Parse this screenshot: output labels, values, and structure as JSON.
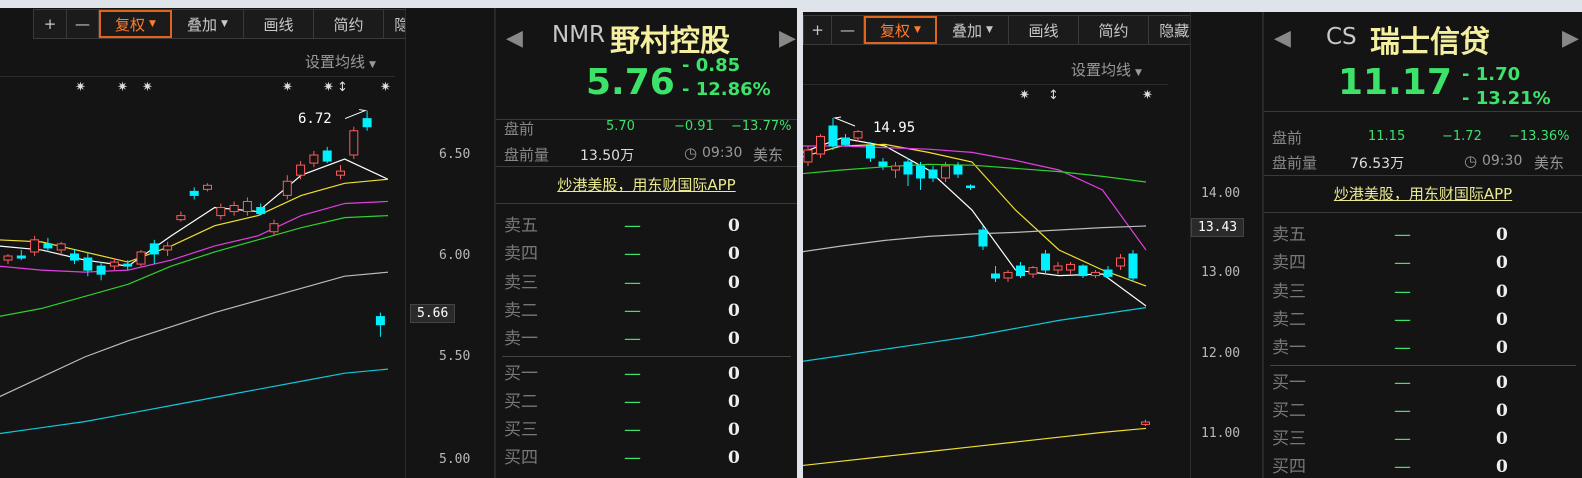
{
  "toolbar": {
    "plus": "+",
    "minus": "—",
    "fuquan": "复权",
    "diejia": "叠加",
    "huaxian": "画线",
    "jianyue": "简约",
    "yincang": "隐藏",
    "expand_icon": "expand-icon"
  },
  "ma_setting": "设置均线",
  "panels": [
    {
      "code": "NMR",
      "name": "野村控股",
      "last": "5.76",
      "change": "- 0.85",
      "change_pct": "- 12.86%",
      "pre_label": "盘前",
      "pre_price": "5.70",
      "pre_change": "−0.91",
      "pre_pct": "−13.77%",
      "pre_vol_label": "盘前量",
      "pre_vol": "13.50万",
      "time": "09:30",
      "tz": "美东",
      "promo": "炒港美股，用东财国际APP",
      "book": [
        {
          "label": "卖五",
          "dash": "—",
          "vol": "0"
        },
        {
          "label": "卖四",
          "dash": "—",
          "vol": "0"
        },
        {
          "label": "卖三",
          "dash": "—",
          "vol": "0"
        },
        {
          "label": "卖二",
          "dash": "—",
          "vol": "0"
        },
        {
          "label": "卖一",
          "dash": "—",
          "vol": "0"
        },
        {
          "label": "买一",
          "dash": "—",
          "vol": "0"
        },
        {
          "label": "买二",
          "dash": "—",
          "vol": "0"
        },
        {
          "label": "买三",
          "dash": "—",
          "vol": "0"
        },
        {
          "label": "买四",
          "dash": "—",
          "vol": "0"
        },
        {
          "label": "买五",
          "dash": "—",
          "vol": "0"
        }
      ]
    },
    {
      "code": "CS",
      "name": "瑞士信贷",
      "last": "11.17",
      "change": "- 1.70",
      "change_pct": "- 13.21%",
      "pre_label": "盘前",
      "pre_price": "11.15",
      "pre_change": "−1.72",
      "pre_pct": "−13.36%",
      "pre_vol_label": "盘前量",
      "pre_vol": "76.53万",
      "time": "09:30",
      "tz": "美东",
      "promo": "炒港美股，用东财国际APP",
      "book": [
        {
          "label": "卖五",
          "dash": "—",
          "vol": "0"
        },
        {
          "label": "卖四",
          "dash": "—",
          "vol": "0"
        },
        {
          "label": "卖三",
          "dash": "—",
          "vol": "0"
        },
        {
          "label": "卖二",
          "dash": "—",
          "vol": "0"
        },
        {
          "label": "卖一",
          "dash": "—",
          "vol": "0"
        },
        {
          "label": "买一",
          "dash": "—",
          "vol": "0"
        },
        {
          "label": "买二",
          "dash": "—",
          "vol": "0"
        },
        {
          "label": "买三",
          "dash": "—",
          "vol": "0"
        },
        {
          "label": "买四",
          "dash": "—",
          "vol": "0"
        }
      ]
    }
  ],
  "chart_data": [
    {
      "type": "candlestick",
      "yticks": [
        "6.50",
        "6.00",
        "5.50",
        "5.00"
      ],
      "current_price": "5.66",
      "high_label": "6.72",
      "colors": {
        "up": "#ff5a5a",
        "down": "#00f0ff"
      },
      "candles": [
        [
          5.98,
          6.01,
          5.96,
          6.0
        ],
        [
          6.0,
          6.03,
          5.98,
          5.99
        ],
        [
          6.02,
          6.1,
          6.0,
          6.08
        ],
        [
          6.06,
          6.09,
          6.02,
          6.04
        ],
        [
          6.03,
          6.07,
          6.0,
          6.06
        ],
        [
          6.01,
          6.03,
          5.96,
          5.98
        ],
        [
          5.99,
          6.02,
          5.9,
          5.93
        ],
        [
          5.95,
          5.97,
          5.88,
          5.91
        ],
        [
          5.95,
          5.99,
          5.93,
          5.97
        ],
        [
          5.96,
          5.98,
          5.93,
          5.95
        ],
        [
          5.96,
          6.03,
          5.95,
          6.02
        ],
        [
          6.06,
          6.08,
          5.96,
          6.01
        ],
        [
          6.03,
          6.07,
          6.0,
          6.05
        ],
        [
          6.18,
          6.22,
          6.17,
          6.2
        ],
        [
          6.32,
          6.34,
          6.28,
          6.3
        ],
        [
          6.33,
          6.36,
          6.32,
          6.35
        ],
        [
          6.2,
          6.26,
          6.18,
          6.24
        ],
        [
          6.22,
          6.27,
          6.2,
          6.25
        ],
        [
          6.22,
          6.29,
          6.2,
          6.27
        ],
        [
          6.24,
          6.26,
          6.2,
          6.21
        ],
        [
          6.12,
          6.18,
          6.1,
          6.16
        ],
        [
          6.3,
          6.4,
          6.28,
          6.37
        ],
        [
          6.4,
          6.47,
          6.38,
          6.45
        ],
        [
          6.46,
          6.52,
          6.44,
          6.5
        ],
        [
          6.52,
          6.54,
          6.46,
          6.47
        ],
        [
          6.4,
          6.45,
          6.38,
          6.42
        ],
        [
          6.5,
          6.64,
          6.48,
          6.62
        ],
        [
          6.68,
          6.72,
          6.62,
          6.64
        ],
        [
          5.7,
          5.72,
          5.6,
          5.66
        ]
      ],
      "ma": [
        {
          "color": "#ffffff",
          "values": [
            6.05,
            6.03,
            5.98,
            5.95,
            6.1,
            6.24,
            6.22,
            6.4,
            6.48,
            6.38
          ]
        },
        {
          "color": "#f0e030",
          "values": [
            6.08,
            6.07,
            6.02,
            5.97,
            6.05,
            6.15,
            6.2,
            6.3,
            6.36,
            6.38
          ]
        },
        {
          "color": "#e040e0",
          "values": [
            5.95,
            5.93,
            5.92,
            5.93,
            5.98,
            6.05,
            6.1,
            6.2,
            6.26,
            6.27
          ]
        },
        {
          "color": "#30d030",
          "values": [
            5.7,
            5.74,
            5.8,
            5.86,
            5.95,
            6.02,
            6.08,
            6.14,
            6.19,
            6.2
          ]
        },
        {
          "color": "#bbbbbb",
          "values": [
            5.3,
            5.4,
            5.5,
            5.58,
            5.65,
            5.72,
            5.78,
            5.84,
            5.9,
            5.92
          ]
        },
        {
          "color": "#10c8d8",
          "values": [
            5.12,
            5.15,
            5.18,
            5.22,
            5.26,
            5.3,
            5.34,
            5.38,
            5.42,
            5.44
          ]
        }
      ]
    },
    {
      "type": "candlestick",
      "yticks": [
        "14.00",
        "13.00",
        "12.00",
        "11.00"
      ],
      "current_price": "13.43",
      "high_label": "14.95",
      "colors": {
        "up": "#ff5a5a",
        "down": "#00f0ff"
      },
      "candles": [
        [
          14.4,
          14.6,
          14.35,
          14.55
        ],
        [
          14.5,
          14.75,
          14.45,
          14.72
        ],
        [
          14.85,
          14.95,
          14.55,
          14.6
        ],
        [
          14.7,
          14.75,
          14.6,
          14.62
        ],
        [
          14.7,
          14.8,
          14.65,
          14.78
        ],
        [
          14.6,
          14.65,
          14.4,
          14.45
        ],
        [
          14.4,
          14.45,
          14.3,
          14.35
        ],
        [
          14.3,
          14.4,
          14.2,
          14.35
        ],
        [
          14.4,
          14.45,
          14.1,
          14.25
        ],
        [
          14.35,
          14.4,
          14.05,
          14.2
        ],
        [
          14.3,
          14.35,
          14.15,
          14.2
        ],
        [
          14.2,
          14.4,
          14.15,
          14.35
        ],
        [
          14.35,
          14.4,
          14.2,
          14.25
        ],
        [
          14.1,
          14.12,
          14.05,
          14.08
        ],
        [
          13.55,
          13.6,
          13.3,
          13.35
        ],
        [
          13.0,
          13.1,
          12.9,
          12.95
        ],
        [
          12.95,
          13.05,
          12.9,
          13.02
        ],
        [
          13.1,
          13.15,
          12.95,
          12.98
        ],
        [
          13.0,
          13.1,
          12.95,
          13.08
        ],
        [
          13.25,
          13.3,
          13.0,
          13.05
        ],
        [
          13.05,
          13.15,
          13.0,
          13.1
        ],
        [
          13.05,
          13.15,
          13.0,
          13.12
        ],
        [
          13.1,
          13.12,
          12.95,
          12.98
        ],
        [
          12.98,
          13.05,
          12.95,
          13.02
        ],
        [
          13.05,
          13.1,
          12.95,
          12.97
        ],
        [
          13.1,
          13.25,
          13.05,
          13.2
        ],
        [
          13.25,
          13.3,
          12.9,
          12.95
        ],
        [
          11.12,
          11.18,
          11.1,
          11.15
        ]
      ],
      "ma": [
        {
          "color": "#ffffff",
          "values": [
            14.5,
            14.7,
            14.6,
            14.3,
            13.8,
            13.05,
            12.98,
            13.0,
            12.6
          ]
        },
        {
          "color": "#f0e030",
          "values": [
            14.45,
            14.6,
            14.62,
            14.52,
            14.4,
            13.8,
            13.3,
            13.05,
            12.85
          ]
        },
        {
          "color": "#e040e0",
          "values": [
            14.6,
            14.6,
            14.58,
            14.56,
            14.52,
            14.42,
            14.3,
            14.05,
            13.3
          ]
        },
        {
          "color": "#30d030",
          "values": [
            14.25,
            14.3,
            14.34,
            14.37,
            14.36,
            14.32,
            14.28,
            14.22,
            14.15
          ]
        },
        {
          "color": "#bbbbbb",
          "values": [
            13.27,
            13.35,
            13.42,
            13.47,
            13.5,
            13.52,
            13.55,
            13.58,
            13.6
          ]
        },
        {
          "color": "#10c8d8",
          "values": [
            11.9,
            11.98,
            12.06,
            12.14,
            12.22,
            12.32,
            12.42,
            12.5,
            12.58
          ]
        },
        {
          "color": "#f0e030",
          "values": [
            10.6,
            10.66,
            10.72,
            10.78,
            10.84,
            10.9,
            10.96,
            11.02,
            11.07
          ]
        }
      ]
    }
  ]
}
